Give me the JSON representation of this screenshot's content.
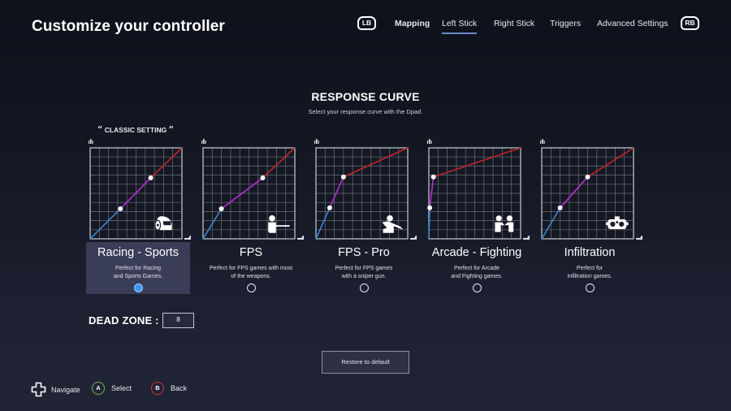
{
  "header": {
    "title": "Customize your controller",
    "left_bumper": "LB",
    "right_bumper": "RB",
    "tabs": [
      {
        "label": "Mapping",
        "active": false
      },
      {
        "label": "Left Stick",
        "active": true
      },
      {
        "label": "Right Stick",
        "active": false
      },
      {
        "label": "Triggers",
        "active": false
      },
      {
        "label": "Advanced Settings",
        "active": false
      }
    ]
  },
  "response_curve": {
    "title": "RESPONSE CURVE",
    "subtitle": "Select your response curve with the Dpad.",
    "classic_label": "CLASSIC SETTING",
    "open_quote": "“",
    "close_quote": "”",
    "selected_index": 0,
    "colors": {
      "low_segment": "#3a86d4",
      "mid_segment": "#b52fd6",
      "high_segment": "#c0262b",
      "grid": "#6b6e7e",
      "border": "#c9cbd3",
      "selected_radio": "#3d95f0"
    },
    "curves": [
      {
        "name": "Racing - Sports",
        "desc_line1": "Perfect for Racing",
        "desc_line2": "and Sports Games.",
        "icon": "helmet-icon",
        "points": [
          [
            0,
            0
          ],
          [
            0.33,
            0.33
          ],
          [
            0.66,
            0.67
          ],
          [
            1,
            1
          ]
        ],
        "selected": true
      },
      {
        "name": "FPS",
        "desc_line1": "Perfect for FPS games with most",
        "desc_line2": "of the weapons.",
        "icon": "rifle-soldier-icon",
        "points": [
          [
            0,
            0
          ],
          [
            0.2,
            0.33
          ],
          [
            0.65,
            0.67
          ],
          [
            1,
            1
          ]
        ],
        "selected": false
      },
      {
        "name": "FPS - Pro",
        "desc_line1": "Perfect for FPS games",
        "desc_line2": "with a sniper gun.",
        "icon": "sniper-icon",
        "points": [
          [
            0,
            0
          ],
          [
            0.15,
            0.34
          ],
          [
            0.3,
            0.68
          ],
          [
            1,
            1
          ]
        ],
        "selected": false
      },
      {
        "name": "Arcade - Fighting",
        "desc_line1": "Perfect for Arcade",
        "desc_line2": "and Fighting games.",
        "icon": "fighters-icon",
        "points": [
          [
            0,
            0
          ],
          [
            0.01,
            0.34
          ],
          [
            0.05,
            0.68
          ],
          [
            1,
            1
          ]
        ],
        "selected": false
      },
      {
        "name": "Infiltration",
        "desc_line1": "Perfect for",
        "desc_line2": "Infiltration games.",
        "icon": "goggles-icon",
        "points": [
          [
            0,
            0
          ],
          [
            0.2,
            0.34
          ],
          [
            0.5,
            0.68
          ],
          [
            1,
            1
          ]
        ],
        "selected": false
      }
    ]
  },
  "dead_zone": {
    "label": "DEAD ZONE :",
    "value": "8"
  },
  "restore_button": "Restore to default",
  "footer": {
    "navigate": "Navigate",
    "select_key": "A",
    "select": "Select",
    "back_key": "B",
    "back": "Back",
    "select_color": "#7ab84a",
    "back_color": "#d0343e"
  }
}
